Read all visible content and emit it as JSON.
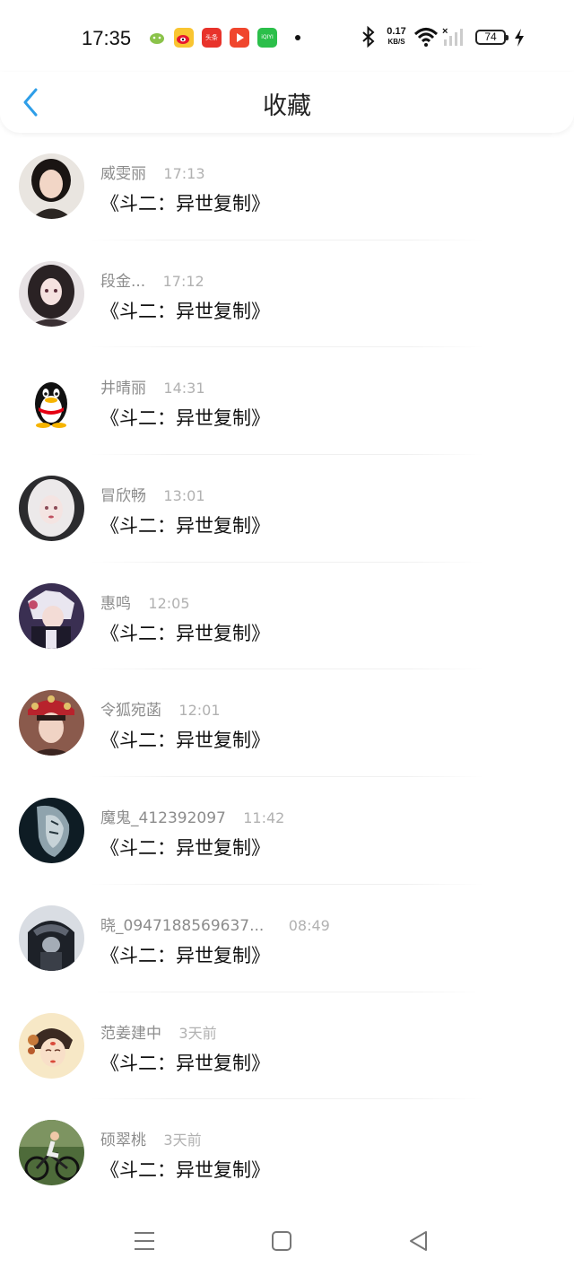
{
  "status_bar": {
    "time": "17:35",
    "net_speed_value": "0.17",
    "net_speed_unit": "KB/S",
    "battery_level": "74",
    "app_icons": [
      {
        "name": "wechat-reading-icon",
        "color": "#8bc34a",
        "label": ""
      },
      {
        "name": "weibo-icon",
        "color": "#f9c531",
        "label": ""
      },
      {
        "name": "toutiao-icon",
        "color": "#e8332b",
        "label": "头条"
      },
      {
        "name": "video-play-icon",
        "color": "#f0462d",
        "label": ""
      },
      {
        "name": "iqiyi-icon",
        "color": "#2bbf4a",
        "label": "iQIYI"
      }
    ]
  },
  "header": {
    "title": "收藏",
    "accent_color": "#2e9ee8"
  },
  "favorites": [
    {
      "name": "威雯丽",
      "time": "17:13",
      "message": "《斗二：异世复制》",
      "avatar": "avatar-woman-black-hair"
    },
    {
      "name": "段金...",
      "time": "17:12",
      "message": "《斗二：异世复制》",
      "avatar": "avatar-anime-girl"
    },
    {
      "name": "井晴丽",
      "time": "14:31",
      "message": "《斗二：异世复制》",
      "avatar": "avatar-qq-penguin"
    },
    {
      "name": "冒欣畅",
      "time": "13:01",
      "message": "《斗二：异世复制》",
      "avatar": "avatar-white-hair-girl"
    },
    {
      "name": "惠鸣",
      "time": "12:05",
      "message": "《斗二：异世复制》",
      "avatar": "avatar-anime-character"
    },
    {
      "name": "令狐宛菡",
      "time": "12:01",
      "message": "《斗二：异世复制》",
      "avatar": "avatar-flower-crown-girl"
    },
    {
      "name": "魔鬼_412392097",
      "time": "11:42",
      "message": "《斗二：异世复制》",
      "avatar": "avatar-dark-portrait"
    },
    {
      "name": "晓_0947188569637...",
      "time": "08:49",
      "message": "《斗二：异世复制》",
      "avatar": "avatar-hooded-figure"
    },
    {
      "name": "范姜建中",
      "time": "3天前",
      "message": "《斗二：异世复制》",
      "avatar": "avatar-opera-illustration"
    },
    {
      "name": "硕翠桃",
      "time": "3天前",
      "message": "《斗二：异世复制》",
      "avatar": "avatar-cyclist"
    }
  ]
}
